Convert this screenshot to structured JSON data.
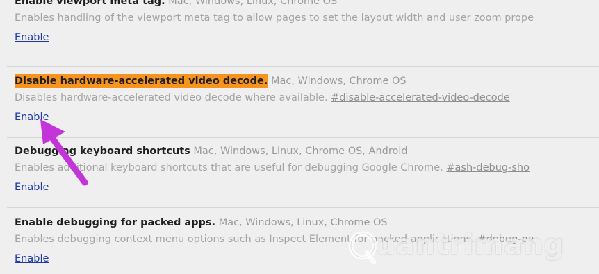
{
  "experiments": [
    {
      "name": "Enable viewport meta tag.",
      "platforms": "Mac, Windows, Linux, Chrome OS",
      "description": "Enables handling of the viewport meta tag to allow pages to set the layout width and user zoom prope",
      "anchor": "",
      "action": "Enable",
      "highlighted": false
    },
    {
      "name": "Disable hardware-accelerated video decode.",
      "platforms": "Mac, Windows, Chrome OS",
      "description": "Disables hardware-accelerated video decode where available.",
      "anchor": "#disable-accelerated-video-decode",
      "action": "Enable",
      "highlighted": true
    },
    {
      "name": "Debugging keyboard shortcuts",
      "platforms": "Mac, Windows, Linux, Chrome OS, Android",
      "description": "Enables additional keyboard shortcuts that are useful for debugging Google Chrome.",
      "anchor": "#ash-debug-sho",
      "action": "Enable",
      "highlighted": false
    },
    {
      "name": "Enable debugging for packed apps.",
      "platforms": "Mac, Windows, Linux, Chrome OS",
      "description": "Enables debugging context menu options such as Inspect Element for packed applications.",
      "anchor": "#debug-pa",
      "action": "Enable",
      "highlighted": false
    }
  ],
  "watermark": {
    "text": "uantrimang",
    "icon": "q-logo-icon"
  },
  "colors": {
    "highlight": "#f7941d",
    "arrow": "#c334d9",
    "link": "#1d3aa8"
  }
}
